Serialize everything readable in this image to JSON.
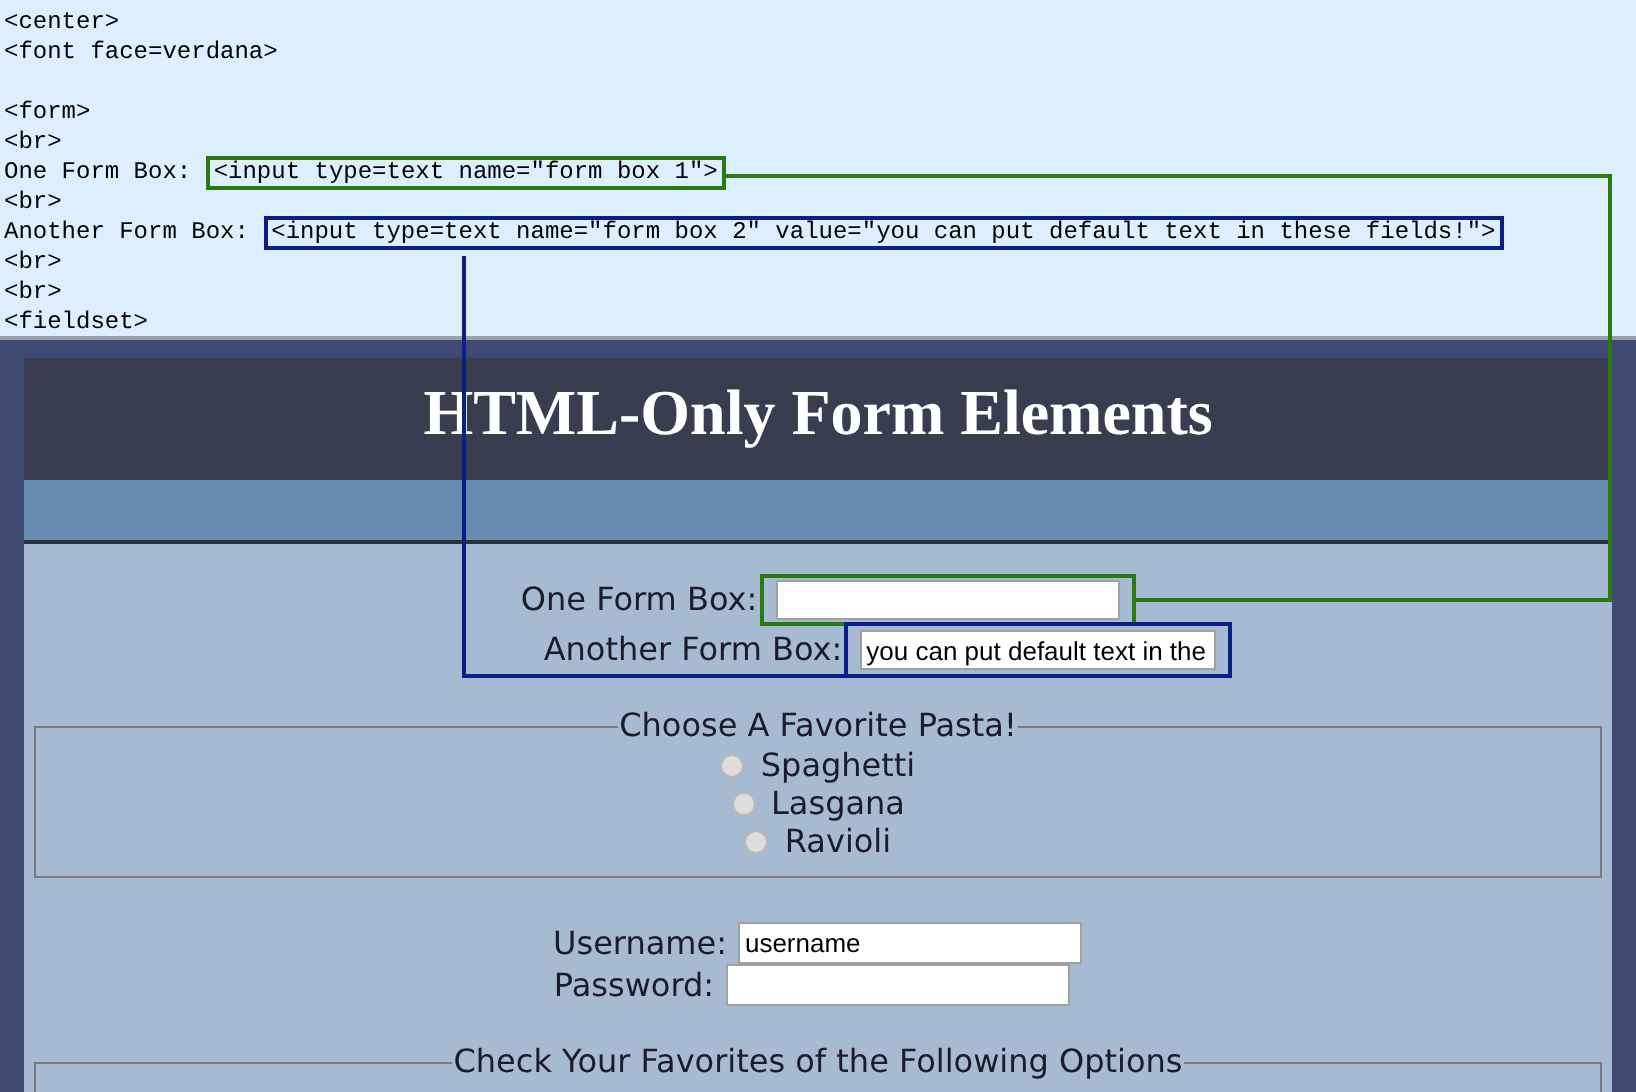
{
  "code_panel": {
    "blocks": [
      {
        "lines": [
          {
            "text": "<center>"
          },
          {
            "text": "<font face=verdana>"
          }
        ]
      },
      {
        "lines": [
          {
            "text": "<form>"
          },
          {
            "text": "<br>"
          },
          {
            "text": "One Form Box: ",
            "callout": "<input type=text name=\"form box 1\">",
            "color": "#2a7a12"
          },
          {
            "text": "<br>"
          },
          {
            "text": "Another Form Box: ",
            "callout": "<input type=text name=\"form box 2\" value=\"you can put default text in these fields!\">",
            "color": "#0b1f86"
          },
          {
            "text": "<br>"
          },
          {
            "text": "<br>"
          },
          {
            "text": "<fieldset>"
          }
        ]
      }
    ]
  },
  "page": {
    "title": "HTML-Only Form Elements",
    "text_fields": [
      {
        "label": "One Form Box:",
        "color": "#2a7a12"
      },
      {
        "label": "Another Form Box:",
        "value": "you can put default text in the",
        "color": "#0b1f86"
      }
    ],
    "pasta": {
      "legend": "Choose A Favorite Pasta!",
      "options": [
        {
          "label": "Spaghetti",
          "selected": false
        },
        {
          "label": "Lasgana",
          "selected": false
        },
        {
          "label": "Ravioli",
          "selected": false
        }
      ]
    },
    "login": [
      {
        "label": "Username:",
        "value": "username"
      },
      {
        "label": "Password:"
      }
    ],
    "options_legend": "Check Your Favorites of the Following Options"
  }
}
